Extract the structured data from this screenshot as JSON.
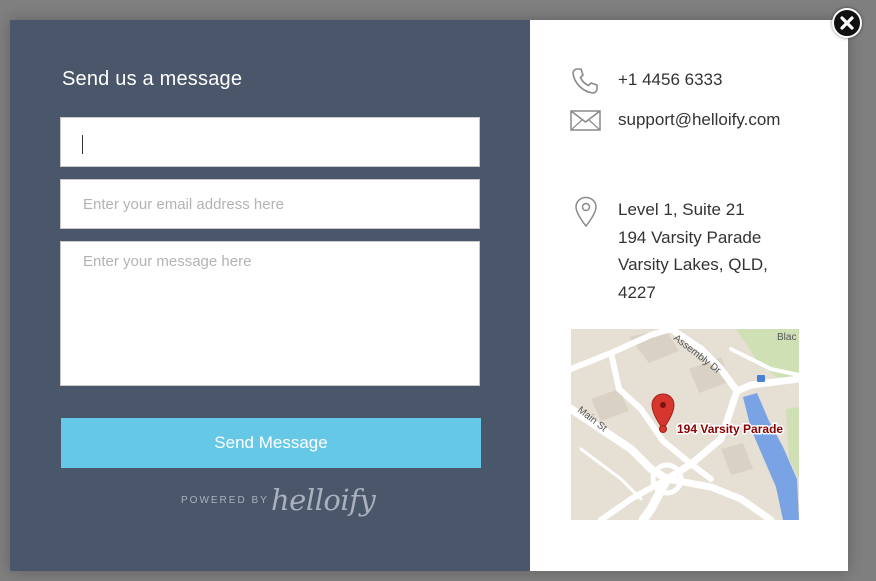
{
  "form": {
    "title": "Send us a message",
    "name_value": "",
    "email_placeholder": "Enter your email address here",
    "message_placeholder": "Enter your message here",
    "submit_label": "Send Message",
    "powered_by": "POWERED BY",
    "brand": "helloify"
  },
  "contact": {
    "phone": "+1 4456 6333",
    "email": "support@helloify.com",
    "address_lines": [
      "Level 1, Suite 21",
      "194 Varsity Parade",
      "Varsity Lakes, QLD,",
      "4227"
    ]
  },
  "map": {
    "pin_label": "194 Varsity Parade",
    "streets": [
      "Assembly Dr",
      "Main St",
      "Blac"
    ]
  },
  "icons": {
    "phone": "phone-icon",
    "email": "envelope-icon",
    "location": "location-pin-icon",
    "close": "close-icon"
  },
  "colors": {
    "panel": "#4a5669",
    "button": "#65c8e7",
    "pin": "#d6362e",
    "pin_label": "#8b0000",
    "water": "#7aa3e6"
  }
}
